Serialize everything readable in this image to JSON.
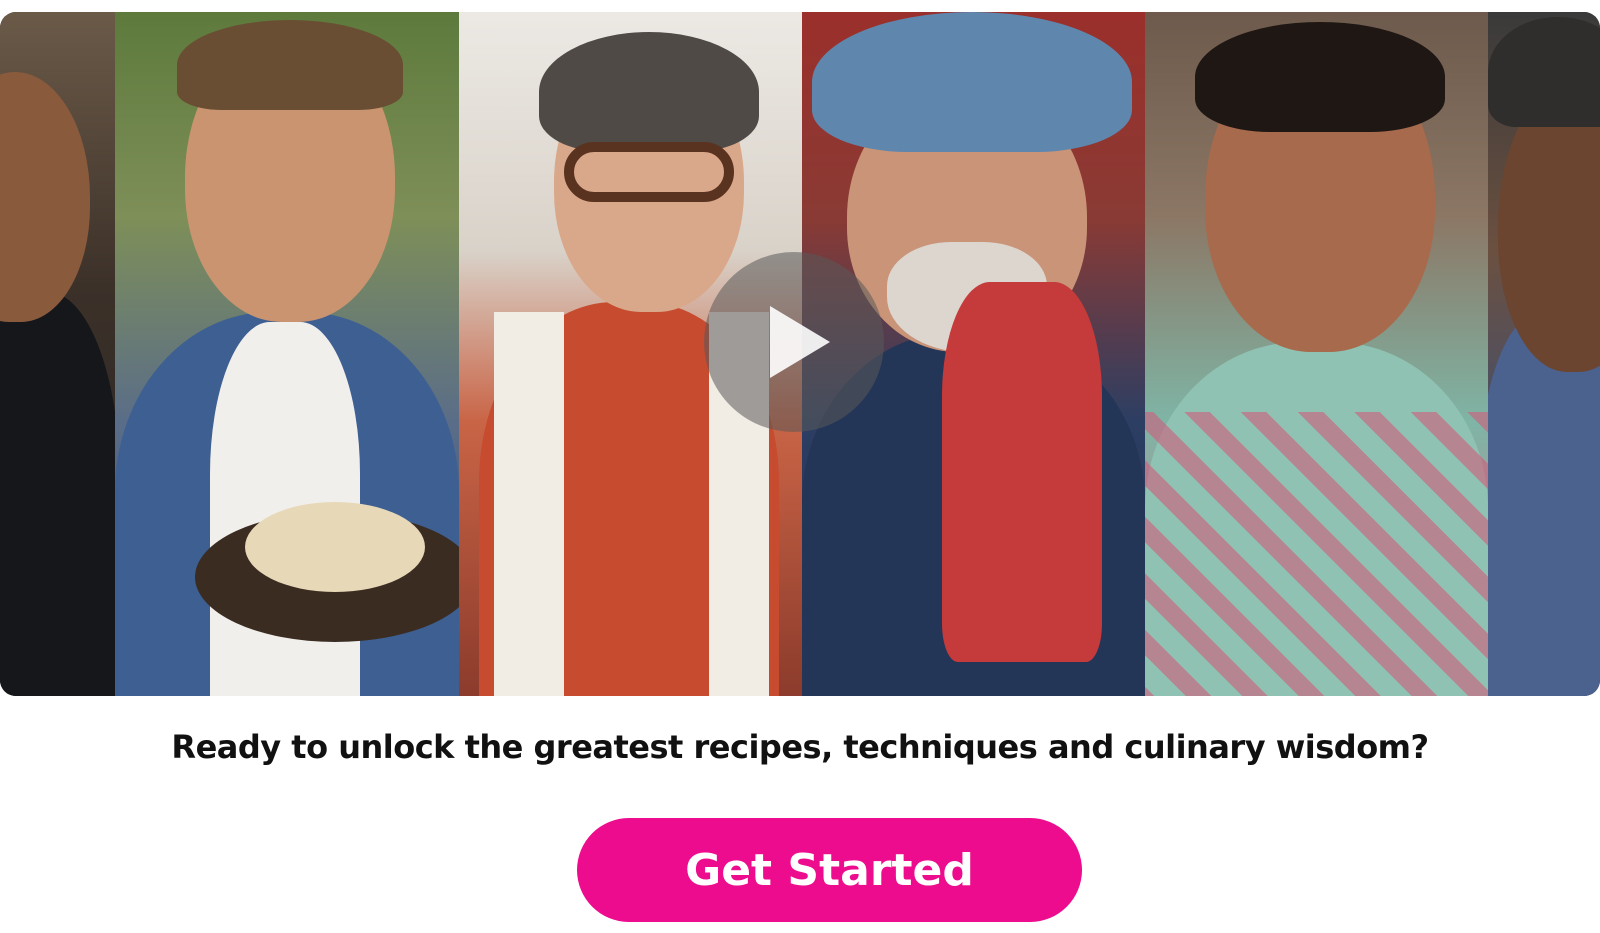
{
  "hero": {
    "panels": [
      {
        "id": "chef-1",
        "icon": "chef-portrait"
      },
      {
        "id": "chef-2",
        "icon": "chef-portrait"
      },
      {
        "id": "chef-3",
        "icon": "chef-portrait"
      },
      {
        "id": "chef-4",
        "icon": "chef-portrait"
      },
      {
        "id": "chef-5",
        "icon": "chef-portrait"
      },
      {
        "id": "chef-6",
        "icon": "chef-portrait"
      }
    ],
    "play_icon": "play-icon"
  },
  "tagline": "Ready to unlock the greatest recipes, techniques and culinary wisdom?",
  "cta": {
    "label": "Get Started",
    "color": "#ec0c8d",
    "text_color": "#ffffff"
  }
}
